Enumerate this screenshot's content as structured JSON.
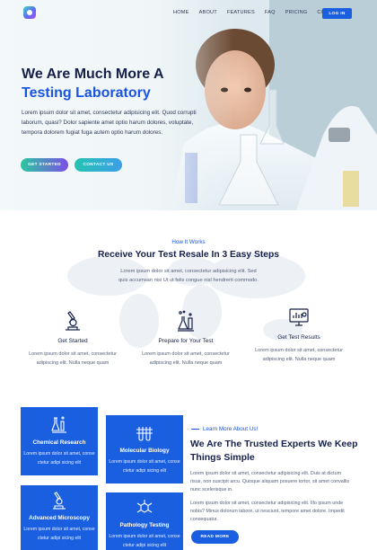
{
  "nav": {
    "items": [
      "HOME",
      "ABOUT",
      "FEATURES",
      "FAQ",
      "PRICING",
      "CONTACT"
    ],
    "login_label": "LOG IN"
  },
  "hero": {
    "title_line1": "We Are Much More A",
    "title_line2": "Testing Laboratory",
    "text": "Lorem ipsum dolor sit amet, consectetur adipisicing elit. Quod corrupti laborum, quasi? Dolor sapiente amet optio harum dolores, voluptate, tempora dolorem fugiat fuga autem optio harum dolores.",
    "get_started_label": "GET STARTED",
    "contact_label": "CONTACT US"
  },
  "steps": {
    "eyebrow": "How It Works",
    "title": "Receive Your Test Resale In 3 Easy Steps",
    "desc": "Lorem ipsum dolor sit amet, consectetur adipisicing elit. Sed quis accumsan nisi Ut ut felis congue nisl hendrerit commodo.",
    "items": [
      {
        "title": "Get Started",
        "text": "Lorem ipsum dolor sit amet, consectetur adipiscing elit. Nulla neque quam",
        "icon": "microscope-icon"
      },
      {
        "title": "Prepare for Your Test",
        "text": "Lorem ipsum dolor sit amet, consectetur adipiscing elit. Nulla neque quam",
        "icon": "lab-flasks-icon"
      },
      {
        "title": "Get Test Results",
        "text": "Lorem ipsum dolor sit amet, consectetur adipiscing elit. Nulla neque quam",
        "icon": "monitor-results-icon"
      }
    ]
  },
  "services": {
    "cards": [
      {
        "title": "Chemical Research",
        "text": "Lorem ipsum dolor sit amet, conse ctetur adipi sicing elit",
        "icon": "flasks-icon"
      },
      {
        "title": "Molecular Biology",
        "text": "Lorem ipsum dolor sit amet, conse ctetur adipi sicing elit",
        "icon": "test-tubes-icon"
      },
      {
        "title": "Advanced Microscopy",
        "text": "Lorem ipsum dolor sit amet, conse ctetur adipi sicing elit",
        "icon": "microscope-icon"
      },
      {
        "title": "Pathology Testing",
        "text": "Lorem ipsum dolor sit amet, conse ctetur adipi sicing elit",
        "icon": "molecule-icon"
      }
    ]
  },
  "about": {
    "eyebrow": "Learn More About Us!",
    "title": "We Are The Trusted Experts We Keep Things Simple",
    "p1": "Lorem ipsum dolor sit amet, consectetur adipisicing elit. Duis at dictum risus, non suscipit arcu. Quisque aliquam posuere tortor, sit amet convallis nunc scelerisque in.",
    "p2": "Lorem ipsum dolor sit amet, consectetur adipisicing elit. Illo ipsum unde nobis? Minus dolorum labore, ut nesciunt, tempore amet dolore. Impedit consequatur.",
    "read_more_label": "READ MORE"
  },
  "colors": {
    "primary": "#1a5fe0",
    "heading": "#15204a",
    "accent_gradient_start": "#2bc7a0",
    "accent_gradient_end": "#7b4fe6"
  }
}
